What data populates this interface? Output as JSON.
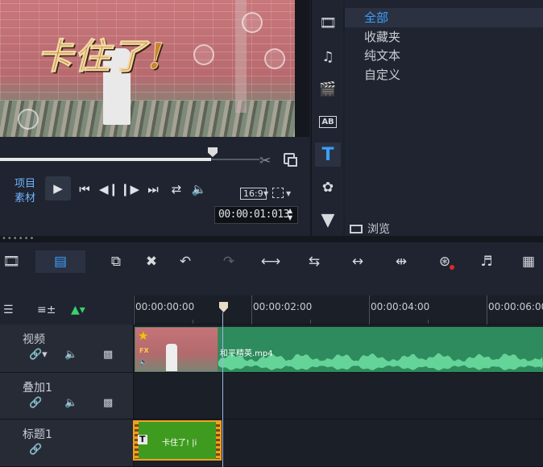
{
  "preview": {
    "overlay_text": "卡住了!",
    "mode_project": "项目",
    "mode_clip": "素材",
    "aspect": "16:9",
    "timecode": "00:00:01:013"
  },
  "library": {
    "items": [
      "全部",
      "收藏夹",
      "纯文本",
      "自定义"
    ],
    "active_index": 0,
    "browse_label": "浏览"
  },
  "ruler": {
    "ticks": [
      "00:00:00:00",
      "00:00:02:00",
      "00:00:04:00",
      "00:00:06:00"
    ]
  },
  "tracks": [
    {
      "name": "视频"
    },
    {
      "name": "叠加1"
    },
    {
      "name": "标题1"
    }
  ],
  "clips": {
    "video_file": "和平精英.mp4",
    "title_text": "卡住了! |i"
  },
  "colors": {
    "accent": "#3ba0ff",
    "audio_clip": "#2e8b5d",
    "title_clip": "#3f9b1f",
    "title_border": "#f0a020"
  }
}
